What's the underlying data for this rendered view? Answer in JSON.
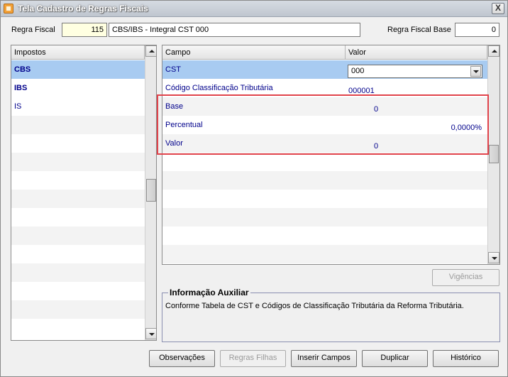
{
  "window": {
    "title": "Tela Cadastro de Regras Fiscais",
    "close": "X"
  },
  "form": {
    "regra_fiscal_label": "Regra Fiscal",
    "regra_fiscal_code": "115",
    "regra_fiscal_desc": "CBS/IBS - Integral CST 000",
    "regra_base_label": "Regra Fiscal Base",
    "regra_base_value": "0"
  },
  "impostos": {
    "header": "Impostos",
    "items": [
      {
        "label": "CBS"
      },
      {
        "label": "IBS"
      },
      {
        "label": "IS"
      }
    ]
  },
  "campos": {
    "headers": {
      "campo": "Campo",
      "valor": "Valor"
    },
    "rows": [
      {
        "campo": "CST",
        "valor": "000"
      },
      {
        "campo": "Código Classificação Tributária",
        "valor": "000001"
      },
      {
        "campo": "Base",
        "valor": "0"
      },
      {
        "campo": "Percentual",
        "valor": "0,0000%"
      },
      {
        "campo": "Valor",
        "valor": "0"
      }
    ]
  },
  "vigencias_button": "Vigências",
  "info": {
    "title": "Informação Auxiliar",
    "text": "Conforme Tabela de CST e Códigos de Classificação Tributária da Reforma Tributária."
  },
  "buttons": {
    "observacoes": "Observações",
    "regras_filhas": "Regras Filhas",
    "inserir_campos": "Inserir Campos",
    "duplicar": "Duplicar",
    "historico": "Histórico"
  },
  "colors": {
    "selected_row": "#a8cbf1",
    "link_text": "#00008b",
    "highlight_box": "#e0434b",
    "code_field_bg": "#ffffe1"
  }
}
